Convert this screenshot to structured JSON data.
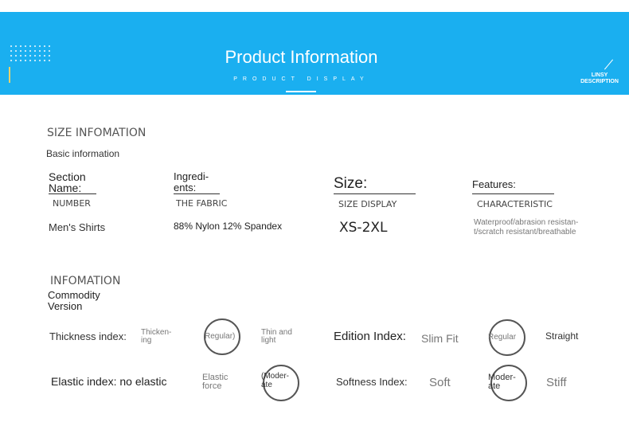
{
  "banner": {
    "title": "Product Information",
    "subtitle": "PRODUCT DISPLAY",
    "brand": "LINSY\nDESCRIPTION"
  },
  "size_info": {
    "heading": "SIZE INFOMATION",
    "subheading": "Basic information",
    "columns": [
      {
        "label": "Section\nName:",
        "sub": "NUMBER",
        "value": "Men's Shirts"
      },
      {
        "label": "Ingredi-\nents:",
        "sub": "THE FABRIC",
        "value": "88% Nylon 12% Spandex"
      },
      {
        "label": "Size:",
        "sub": "SIZE DISPLAY",
        "value": "XS-2XL"
      },
      {
        "label": "Features:",
        "sub": "CHARACTERISTIC",
        "value": "Waterproof/abrasion resistan-\nt/scratch resistant/breathable"
      }
    ]
  },
  "version_info": {
    "heading": "INFOMATION",
    "subheading": "Commodity\nVersion",
    "rows": [
      {
        "label": "Thickness index:",
        "options": [
          "Thicken-\ning",
          "Regular)",
          "Thin and\nlight"
        ],
        "selected": 1
      },
      {
        "label": "Edition Index:",
        "options": [
          "Slim Fit",
          "Regular",
          "Straight"
        ],
        "selected": 1
      },
      {
        "label": "Elastic index: no elastic",
        "options": [
          "Elastic\nforce",
          "(Moder-\nate"
        ],
        "selected": 1
      },
      {
        "label": "Softness Index:",
        "options": [
          "Soft",
          "Moder-\nate",
          "Stiff"
        ],
        "selected": 1
      }
    ]
  }
}
